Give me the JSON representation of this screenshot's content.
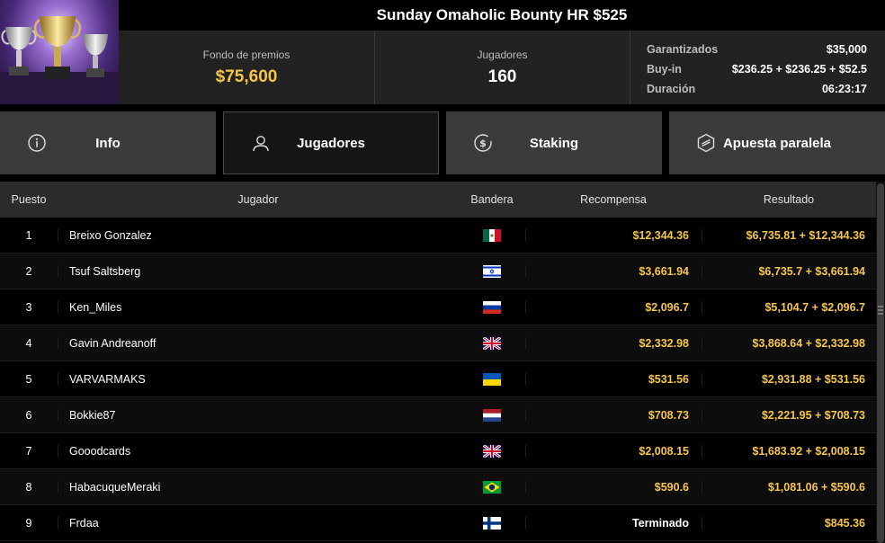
{
  "tournament": {
    "title": "Sunday Omaholic Bounty HR $525",
    "thumbnail_icon": "trophy-cups-icon"
  },
  "stats": {
    "prize_pool_label": "Fondo de premios",
    "prize_pool_value": "$75,600",
    "players_label": "Jugadores",
    "players_value": "160",
    "guaranteed_label": "Garantizados",
    "guaranteed_value": "$35,000",
    "buyin_label": "Buy-in",
    "buyin_value": "$236.25 + $236.25 + $52.5",
    "duration_label": "Duración",
    "duration_value": "06:23:17"
  },
  "tabs": [
    {
      "label": "Info",
      "icon": "info-icon"
    },
    {
      "label": "Jugadores",
      "icon": "user-icon"
    },
    {
      "label": "Staking",
      "icon": "dollar-coin-icon"
    },
    {
      "label": "Apuesta paralela",
      "icon": "side-bet-icon"
    }
  ],
  "active_tab": "Jugadores",
  "table": {
    "headers": {
      "position": "Puesto",
      "player": "Jugador",
      "flag": "Bandera",
      "reward": "Recompensa",
      "result": "Resultado"
    },
    "rows": [
      {
        "position": "1",
        "player": "Breixo Gonzalez",
        "flag": "mexico",
        "reward": "$12,344.36",
        "result": "$6,735.81 + $12,344.36"
      },
      {
        "position": "2",
        "player": "Tsuf Saltsberg",
        "flag": "israel",
        "reward": "$3,661.94",
        "result": "$6,735.7 + $3,661.94"
      },
      {
        "position": "3",
        "player": "Ken_Miles",
        "flag": "russia",
        "reward": "$2,096.7",
        "result": "$5,104.7 + $2,096.7"
      },
      {
        "position": "4",
        "player": "Gavin Andreanoff",
        "flag": "united-kingdom",
        "reward": "$2,332.98",
        "result": "$3,868.64 + $2,332.98"
      },
      {
        "position": "5",
        "player": "VARVARMAKS",
        "flag": "ukraine",
        "reward": "$531.56",
        "result": "$2,931.88 + $531.56"
      },
      {
        "position": "6",
        "player": "Bokkie87",
        "flag": "netherlands",
        "reward": "$708.73",
        "result": "$2,221.95 + $708.73"
      },
      {
        "position": "7",
        "player": "Gooodcards",
        "flag": "united-kingdom",
        "reward": "$2,008.15",
        "result": "$1,683.92 + $2,008.15"
      },
      {
        "position": "8",
        "player": "HabacuqueMeraki",
        "flag": "brazil",
        "reward": "$590.6",
        "result": "$1,081.06 + $590.6"
      },
      {
        "position": "9",
        "player": "Frdaa",
        "flag": "finland",
        "reward": "Terminado",
        "result": "$845.36"
      }
    ]
  },
  "colors": {
    "gold": "#f6c64b",
    "tab_bg": "#3b3b3b",
    "active_tab_bg": "#151515",
    "header_bg": "#222222"
  }
}
